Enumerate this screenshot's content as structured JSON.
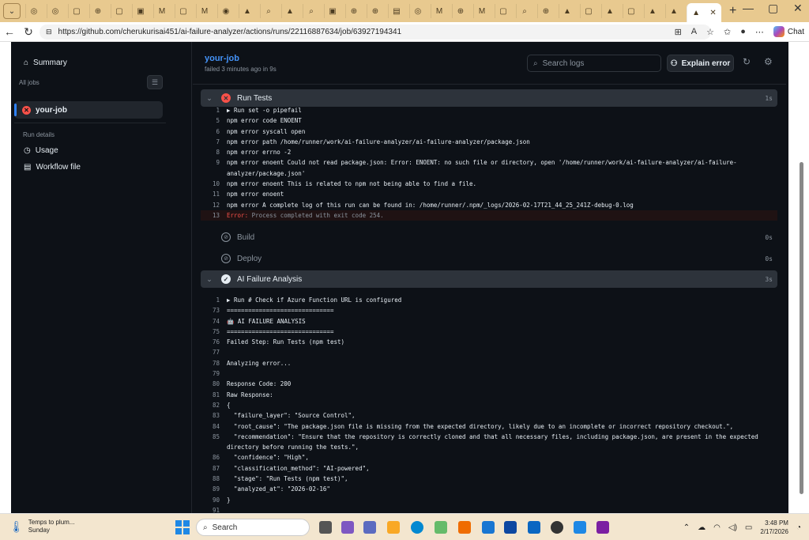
{
  "browser": {
    "url": "https://github.com/cherukurisai451/ai-failure-analyzer/actions/runs/22116887634/job/63927194341",
    "chat_label": "Chat"
  },
  "sidebar": {
    "summary_label": "Summary",
    "all_jobs_label": "All jobs",
    "job_label": "your-job",
    "run_details_label": "Run details",
    "usage_label": "Usage",
    "workflow_file_label": "Workflow file"
  },
  "job": {
    "title": "your-job",
    "subtitle": "failed 3 minutes ago in 9s",
    "search_placeholder": "Search logs",
    "explain_label": "Explain error"
  },
  "steps": {
    "run_tests": {
      "name": "Run Tests",
      "duration": "1s",
      "log": [
        {
          "n": "1",
          "t": "▶ Run set -o pipefail"
        },
        {
          "n": "5",
          "t": "npm error code ENOENT"
        },
        {
          "n": "6",
          "t": "npm error syscall open"
        },
        {
          "n": "7",
          "t": "npm error path /home/runner/work/ai-failure-analyzer/ai-failure-analyzer/package.json"
        },
        {
          "n": "8",
          "t": "npm error errno -2"
        },
        {
          "n": "9",
          "t": "npm error enoent Could not read package.json: Error: ENOENT: no such file or directory, open '/home/runner/work/ai-failure-analyzer/ai-failure-"
        },
        {
          "n": "",
          "t": "analyzer/package.json'"
        },
        {
          "n": "10",
          "t": "npm error enoent This is related to npm not being able to find a file."
        },
        {
          "n": "11",
          "t": "npm error enoent"
        },
        {
          "n": "12",
          "t": "npm error A complete log of this run can be found in: /home/runner/.npm/_logs/2026-02-17T21_44_25_241Z-debug-0.log"
        }
      ],
      "error_line": {
        "n": "13",
        "label": "Error:",
        "t": " Process completed with exit code 254."
      }
    },
    "build": {
      "name": "Build",
      "duration": "0s"
    },
    "deploy": {
      "name": "Deploy",
      "duration": "0s"
    },
    "ai_analysis": {
      "name": "AI Failure Analysis",
      "duration": "3s",
      "log": [
        {
          "n": "1",
          "t": "▶ Run # Check if Azure Function URL is configured"
        },
        {
          "n": "73",
          "t": "=============================="
        },
        {
          "n": "74",
          "t": "🤖 AI FAILURE ANALYSIS"
        },
        {
          "n": "75",
          "t": "=============================="
        },
        {
          "n": "76",
          "t": "Failed Step: Run Tests (npm test)"
        },
        {
          "n": "77",
          "t": ""
        },
        {
          "n": "78",
          "t": "Analyzing error..."
        },
        {
          "n": "79",
          "t": ""
        },
        {
          "n": "80",
          "t": "Response Code: 200"
        },
        {
          "n": "81",
          "t": "Raw Response:"
        },
        {
          "n": "82",
          "t": "{"
        },
        {
          "n": "83",
          "t": "  \"failure_layer\": \"Source Control\","
        },
        {
          "n": "84",
          "t": "  \"root_cause\": \"The package.json file is missing from the expected directory, likely due to an incomplete or incorrect repository checkout.\","
        },
        {
          "n": "85",
          "t": "  \"recommendation\": \"Ensure that the repository is correctly cloned and that all necessary files, including package.json, are present in the expected"
        },
        {
          "n": "",
          "t": "directory before running the tests.\","
        },
        {
          "n": "86",
          "t": "  \"confidence\": \"High\","
        },
        {
          "n": "87",
          "t": "  \"classification_method\": \"AI-powered\","
        },
        {
          "n": "88",
          "t": "  \"stage\": \"Run Tests (npm test)\","
        },
        {
          "n": "89",
          "t": "  \"analyzed_at\": \"2026-02-16\""
        },
        {
          "n": "90",
          "t": "}"
        },
        {
          "n": "91",
          "t": ""
        }
      ]
    }
  },
  "taskbar": {
    "weather_line1": "Temps to plum...",
    "weather_line2": "Sunday",
    "search_label": "Search",
    "time": "3:48 PM",
    "date": "2/17/2026"
  }
}
